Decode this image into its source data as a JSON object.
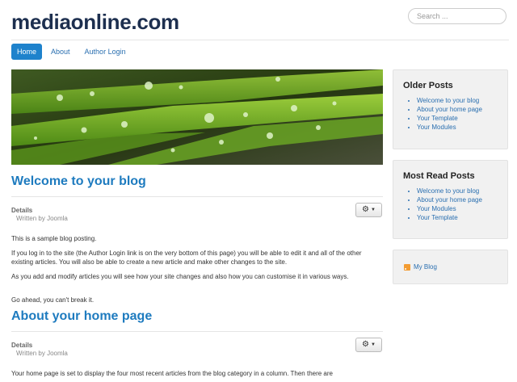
{
  "site": {
    "title": "mediaonline.com"
  },
  "search": {
    "placeholder": "Search ..."
  },
  "nav": {
    "items": [
      {
        "label": "Home",
        "active": true
      },
      {
        "label": "About",
        "active": false
      },
      {
        "label": "Author Login",
        "active": false
      }
    ]
  },
  "articles": [
    {
      "title": "Welcome to your blog",
      "details_label": "Details",
      "written_by": "Written by Joomla",
      "paragraphs": [
        "This is a sample blog posting.",
        "If you log in to the site (the Author Login link is on the very bottom of this page) you will be able to edit it and all of the other existing articles. You will also be able to create a new article and make other changes to the site.",
        "As you add and modify articles you will see how your site changes and also how you can customise it in various ways.",
        "Go ahead, you can't break it."
      ]
    },
    {
      "title": "About your home page",
      "details_label": "Details",
      "written_by": "Written by Joomla",
      "paragraphs": [
        "Your home page is set to display the four most recent articles from the blog category in a column. Then there are"
      ]
    }
  ],
  "sidebar": {
    "older_posts": {
      "title": "Older Posts",
      "items": [
        "Welcome to your blog",
        "About your home page",
        "Your Template",
        "Your Modules"
      ]
    },
    "most_read": {
      "title": "Most Read Posts",
      "items": [
        "Welcome to your blog",
        "About your home page",
        "Your Modules",
        "Your Template"
      ]
    },
    "rss": {
      "label": "My Blog"
    }
  },
  "icons": {
    "gear": "gear-icon",
    "caret": "caret-down-icon",
    "rss": "rss-feed-icon"
  },
  "colors": {
    "accent": "#1e82cc",
    "link": "#2a6fb0",
    "heading": "#1e7bbf",
    "title": "#1d2f4f"
  }
}
